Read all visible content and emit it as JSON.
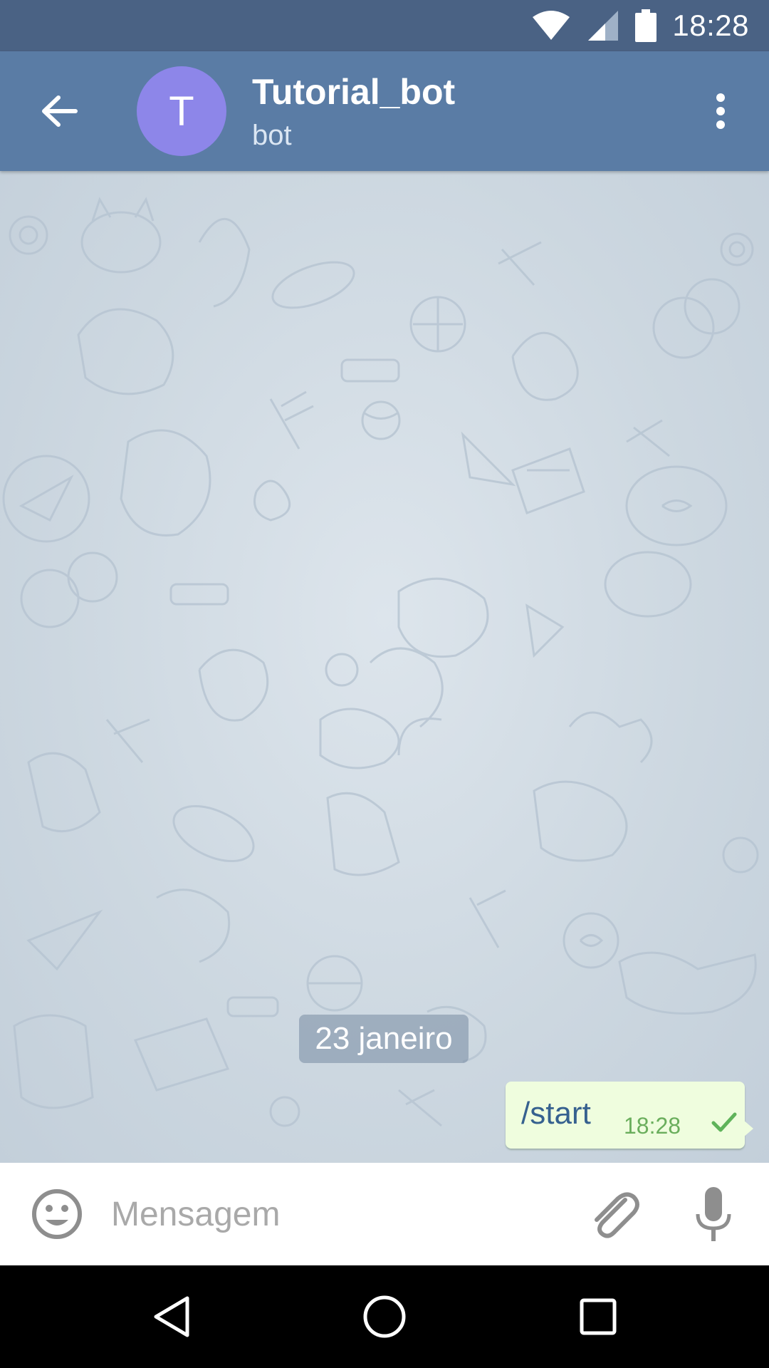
{
  "status_bar": {
    "time": "18:28",
    "icons": [
      "wifi-icon",
      "cell-signal-icon",
      "battery-icon"
    ]
  },
  "header": {
    "back_icon": "arrow-left-icon",
    "avatar_initial": "T",
    "avatar_color": "#8d86e9",
    "title": "Tutorial_bot",
    "subtitle": "bot",
    "menu_icon": "more-vertical-icon"
  },
  "chat": {
    "date_label": "23 janeiro",
    "messages": [
      {
        "text": "/start",
        "time": "18:28",
        "status_icon": "check-icon",
        "outgoing": true
      }
    ]
  },
  "composer": {
    "placeholder": "Mensagem",
    "value": "",
    "emoji_icon": "smiley-icon",
    "attach_icon": "paperclip-icon",
    "mic_icon": "microphone-icon"
  },
  "nav_bar": {
    "buttons": [
      "back-triangle-icon",
      "home-circle-icon",
      "recents-square-icon"
    ]
  },
  "colors": {
    "status_bar": "#4a6284",
    "header": "#5a7ca5",
    "bubble_out": "#effdde",
    "accent_green": "#6aae5c"
  }
}
